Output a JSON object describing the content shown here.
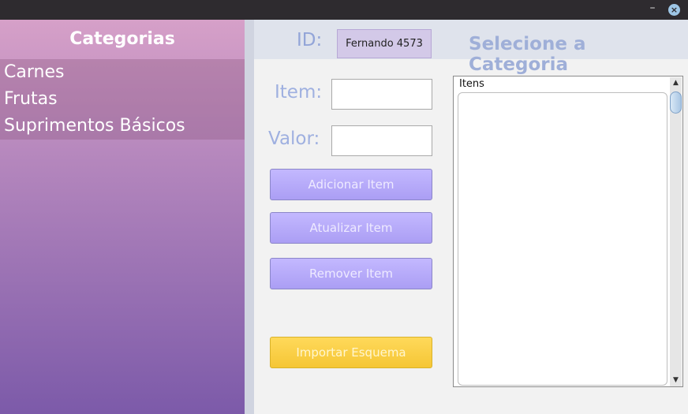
{
  "window": {
    "minimize_glyph": "–",
    "close_glyph": "×"
  },
  "sidebar": {
    "heading": "Categorias",
    "items": [
      {
        "label": "Carnes"
      },
      {
        "label": "Frutas"
      },
      {
        "label": "Suprimentos Básicos"
      }
    ]
  },
  "header": {
    "id_label": "ID:",
    "id_value": "Fernando 4573",
    "title": "Selecione a Categoria"
  },
  "form": {
    "item_label": "Item:",
    "item_value": "",
    "valor_label": "Valor:",
    "valor_value": ""
  },
  "buttons": {
    "add": "Adicionar Item",
    "update": "Atualizar Item",
    "remove": "Remover Item",
    "import": "Importar Esquema"
  },
  "list": {
    "header": "Itens",
    "items": []
  },
  "scrollbar": {
    "up_glyph": "▲",
    "down_glyph": "▼"
  },
  "colors": {
    "button_accent": "#b3a6f8",
    "import_accent": "#f8cd45"
  }
}
